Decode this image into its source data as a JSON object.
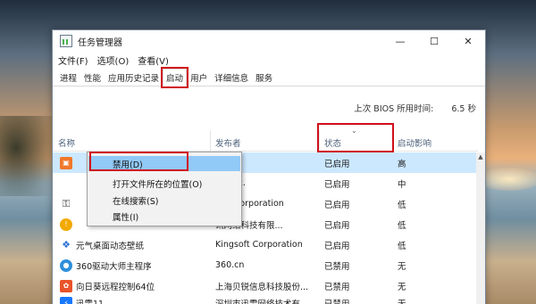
{
  "window": {
    "title": "任务管理器",
    "controls": {
      "minimize": "—",
      "maximize": "☐",
      "close": "✕"
    }
  },
  "menu": [
    "文件(F)",
    "选项(O)",
    "查看(V)"
  ],
  "tabs": [
    "进程",
    "性能",
    "应用历史记录",
    "启动",
    "用户",
    "详细信息",
    "服务"
  ],
  "active_tab": "启动",
  "bios": {
    "label": "上次 BIOS 所用时间:",
    "value": "6.5 秒"
  },
  "columns": {
    "name": "名称",
    "publisher": "发布者",
    "status": "状态",
    "impact": "启动影响"
  },
  "rows": [
    {
      "name": "",
      "publisher": "",
      "status": "已启用",
      "impact": "高",
      "icon": "orange-app-icon",
      "icon_color": "#f0782a"
    },
    {
      "name": "",
      "publisher": "se, Inc.",
      "status": "已启用",
      "impact": "中",
      "icon": "",
      "icon_color": ""
    },
    {
      "name": "",
      "publisher": "soft Corporation",
      "status": "已启用",
      "impact": "低",
      "icon": "shield-icon",
      "icon_color": "#333333"
    },
    {
      "name": "",
      "publisher": "讯网络科技有限...",
      "status": "已启用",
      "impact": "低",
      "icon": "warning-icon",
      "icon_color": "#f2a900"
    },
    {
      "name": "元气桌面动态壁纸",
      "publisher": "Kingsoft Corporation",
      "status": "已启用",
      "impact": "低",
      "icon": "grid-app-icon",
      "icon_color": "#2a6fd6"
    },
    {
      "name": "360驱动大师主程序",
      "publisher": "360.cn",
      "status": "已禁用",
      "impact": "无",
      "icon": "360-icon",
      "icon_color": "#2f8fdb"
    },
    {
      "name": "向日葵远程控制64位",
      "publisher": "上海贝锐信息科技股份...",
      "status": "已禁用",
      "impact": "无",
      "icon": "sunflower-icon",
      "icon_color": "#e8532a"
    },
    {
      "name": "迅雷11",
      "publisher": "深圳市迅雷网络技术有...",
      "status": "已禁用",
      "impact": "无",
      "icon": "thunder-icon",
      "icon_color": "#1677ff"
    }
  ],
  "context_menu": [
    "禁用(D)",
    "打开文件所在的位置(O)",
    "在线搜索(S)",
    "属性(I)"
  ],
  "colors": {
    "highlight": "#d0101a",
    "selected_row": "#cce8ff",
    "menu_hover": "#91c9f7"
  }
}
